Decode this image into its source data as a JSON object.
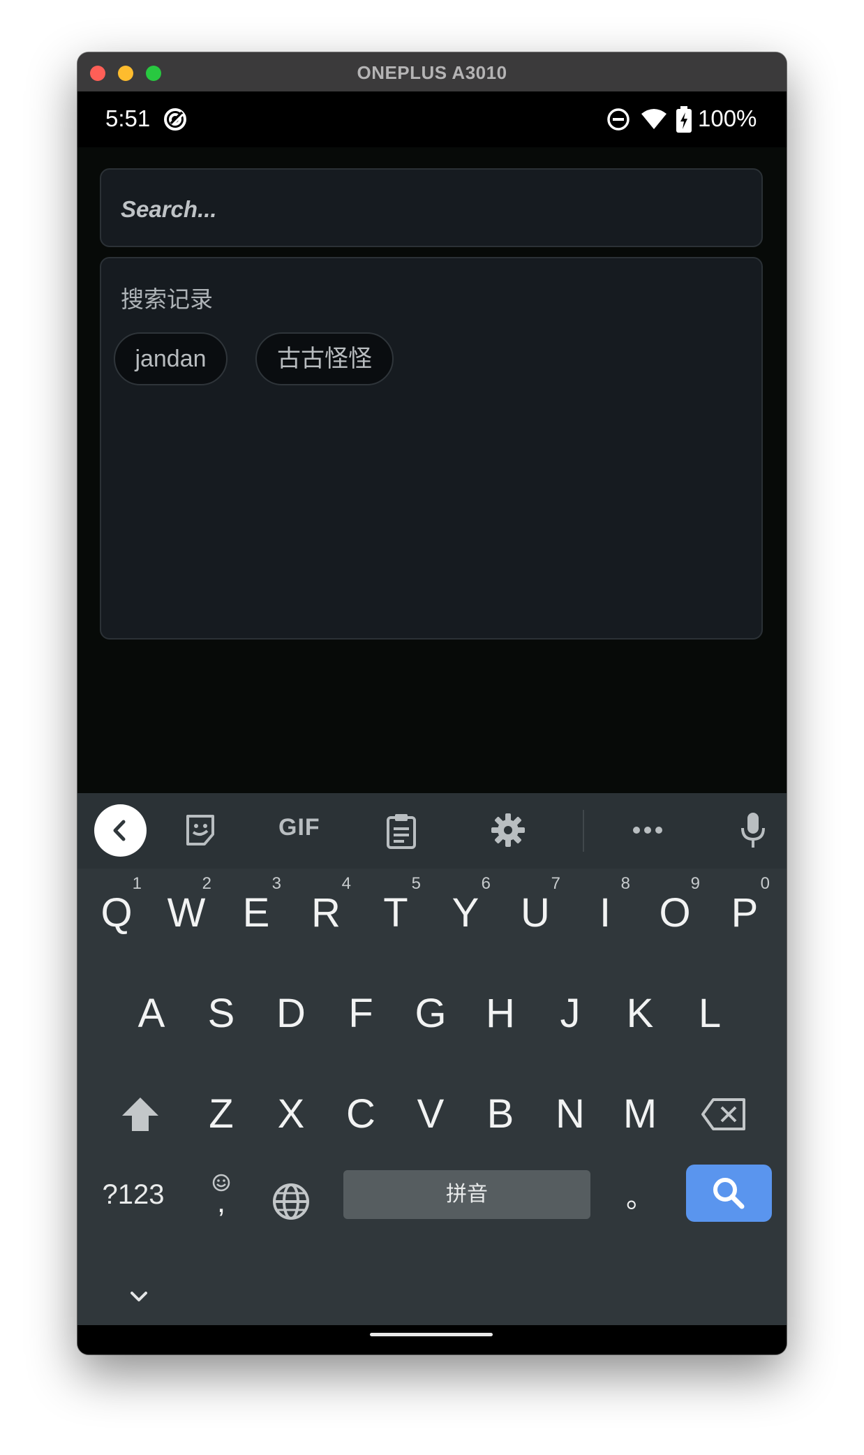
{
  "window": {
    "title": "ONEPLUS A3010"
  },
  "status_bar": {
    "time": "5:51",
    "battery": "100%"
  },
  "search": {
    "placeholder": "Search..."
  },
  "history": {
    "title": "搜索记录",
    "chips": [
      "jandan",
      "古古怪怪"
    ]
  },
  "keyboard": {
    "toolbar": {
      "gif_label": "GIF"
    },
    "row1": [
      {
        "key": "Q",
        "hint": "1"
      },
      {
        "key": "W",
        "hint": "2"
      },
      {
        "key": "E",
        "hint": "3"
      },
      {
        "key": "R",
        "hint": "4"
      },
      {
        "key": "T",
        "hint": "5"
      },
      {
        "key": "Y",
        "hint": "6"
      },
      {
        "key": "U",
        "hint": "7"
      },
      {
        "key": "I",
        "hint": "8"
      },
      {
        "key": "O",
        "hint": "9"
      },
      {
        "key": "P",
        "hint": "0"
      }
    ],
    "row2": [
      "A",
      "S",
      "D",
      "F",
      "G",
      "H",
      "J",
      "K",
      "L"
    ],
    "row3": [
      "Z",
      "X",
      "C",
      "V",
      "B",
      "N",
      "M"
    ],
    "symbols_label": "?123",
    "comma": ",",
    "space_label": "拼音",
    "period": "。"
  },
  "colors": {
    "accent": "#5a95ee",
    "background": "#070a08",
    "panel": "#161b20",
    "keyboard": "#30373b"
  }
}
